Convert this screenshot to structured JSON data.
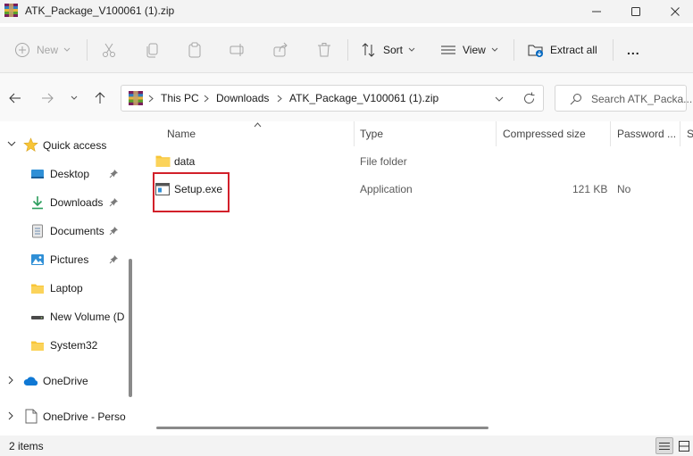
{
  "window": {
    "title": "ATK_Package_V100061 (1).zip",
    "controls": [
      "minimize-icon",
      "maximize-icon",
      "close-icon"
    ]
  },
  "toolbar": {
    "new_label": "New",
    "sort_label": "Sort",
    "view_label": "View",
    "extract_label": "Extract all",
    "more_label": "...",
    "icons": [
      "cut-icon",
      "copy-icon",
      "paste-icon",
      "rename-icon",
      "share-icon",
      "delete-icon"
    ]
  },
  "address": {
    "crumbs": [
      "This PC",
      "Downloads",
      "ATK_Package_V100061 (1).zip"
    ]
  },
  "search": {
    "placeholder": "Search ATK_Packa..."
  },
  "nav": {
    "quick_access": "Quick access",
    "items": [
      {
        "label": "Desktop",
        "icon": "desktop-icon",
        "pinned": true
      },
      {
        "label": "Downloads",
        "icon": "download-icon",
        "pinned": true
      },
      {
        "label": "Documents",
        "icon": "documents-icon",
        "pinned": true
      },
      {
        "label": "Pictures",
        "icon": "pictures-icon",
        "pinned": true
      },
      {
        "label": "Laptop",
        "icon": "folder-icon",
        "pinned": false
      },
      {
        "label": "New Volume (D",
        "icon": "drive-icon",
        "pinned": false
      },
      {
        "label": "System32",
        "icon": "folder-icon",
        "pinned": false
      }
    ],
    "onedrive": "OneDrive",
    "onedrive_personal": "OneDrive - Perso"
  },
  "columns": {
    "name": "Name",
    "type": "Type",
    "compressed_size": "Compressed size",
    "password": "Password ...",
    "extra": "S"
  },
  "files": [
    {
      "name": "data",
      "type": "File folder",
      "size": "",
      "password": "",
      "icon": "folder-icon"
    },
    {
      "name": "Setup.exe",
      "type": "Application",
      "size": "121 KB",
      "password": "No",
      "icon": "application-icon"
    }
  ],
  "status": {
    "item_count": "2 items"
  },
  "colors": {
    "highlight": "#d2202a",
    "folder": "#f8c537",
    "accent": "#0067c0"
  }
}
